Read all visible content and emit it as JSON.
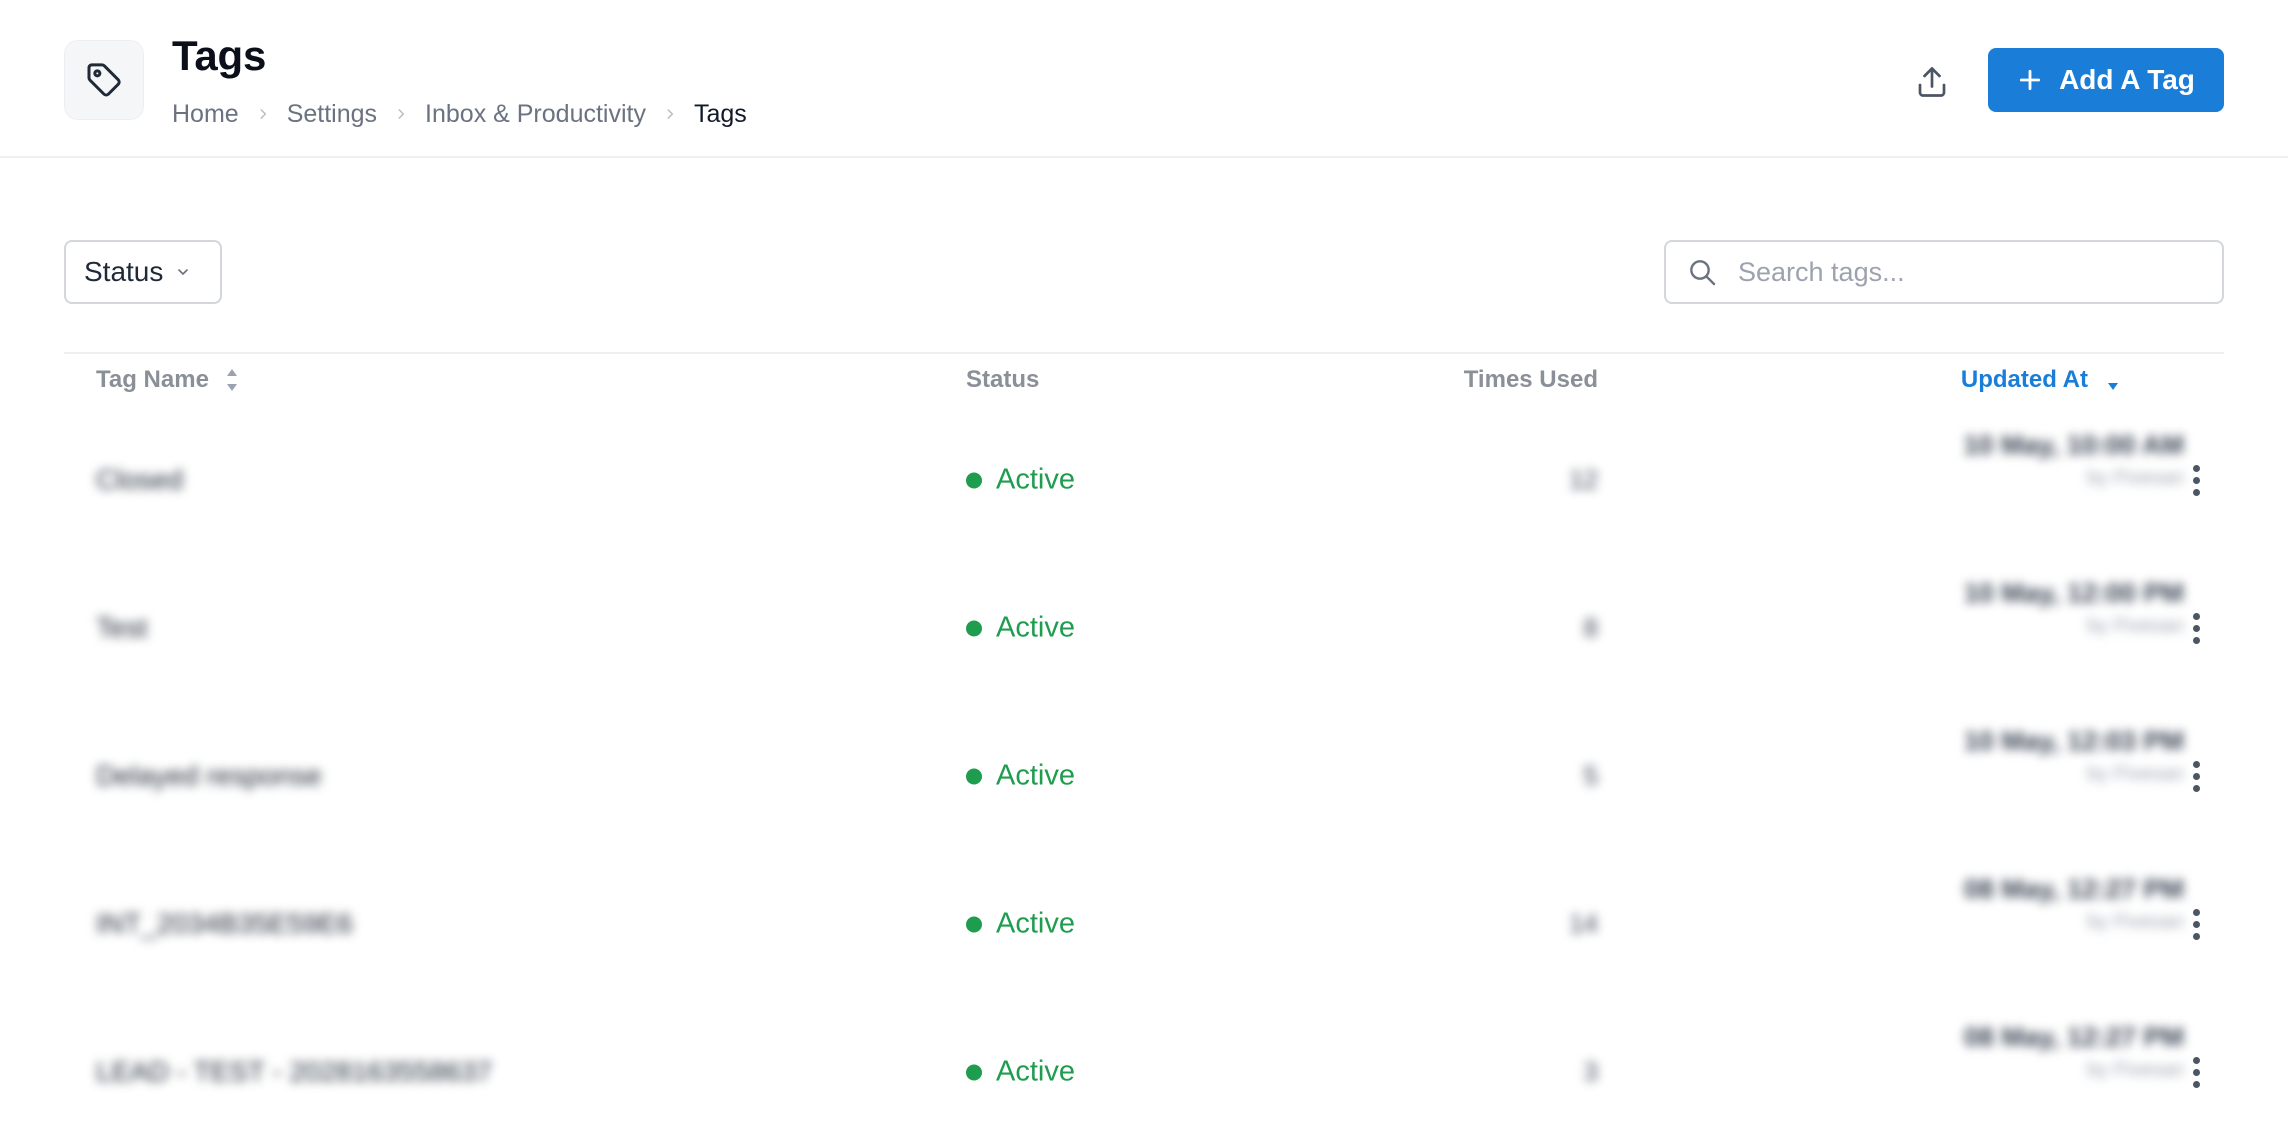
{
  "header": {
    "title": "Tags",
    "icon": "tag-icon",
    "breadcrumbs": [
      "Home",
      "Settings",
      "Inbox & Productivity",
      "Tags"
    ],
    "export_icon": "upload-icon",
    "add_button_label": "Add A Tag",
    "accent_color": "#1a7ed8"
  },
  "toolbar": {
    "status_filter_label": "Status",
    "search_placeholder": "Search tags...",
    "search_value": ""
  },
  "table": {
    "columns": {
      "name": "Tag Name",
      "status": "Status",
      "times_used": "Times Used",
      "updated_at": "Updated At"
    },
    "sorted_column": "updated_at",
    "sort_direction": "desc",
    "status_color": "#1f9d4f",
    "rows": [
      {
        "name": "Closed",
        "status": "Active",
        "times_used": "12",
        "updated_date": "10 May, 10:00 AM",
        "updated_by": "by Fivesan"
      },
      {
        "name": "Test",
        "status": "Active",
        "times_used": "8",
        "updated_date": "10 May, 12:00 PM",
        "updated_by": "by Fivesan"
      },
      {
        "name": "Delayed response",
        "status": "Active",
        "times_used": "5",
        "updated_date": "10 May, 12:03 PM",
        "updated_by": "by Fivesan"
      },
      {
        "name": "INT_2034B35E59E6",
        "status": "Active",
        "times_used": "14",
        "updated_date": "08 May, 12:27 PM",
        "updated_by": "by Fivesan"
      },
      {
        "name": "LEAD - TEST - 2028163558637",
        "status": "Active",
        "times_used": "3",
        "updated_date": "08 May, 12:27 PM",
        "updated_by": "by Fivesan"
      }
    ]
  }
}
